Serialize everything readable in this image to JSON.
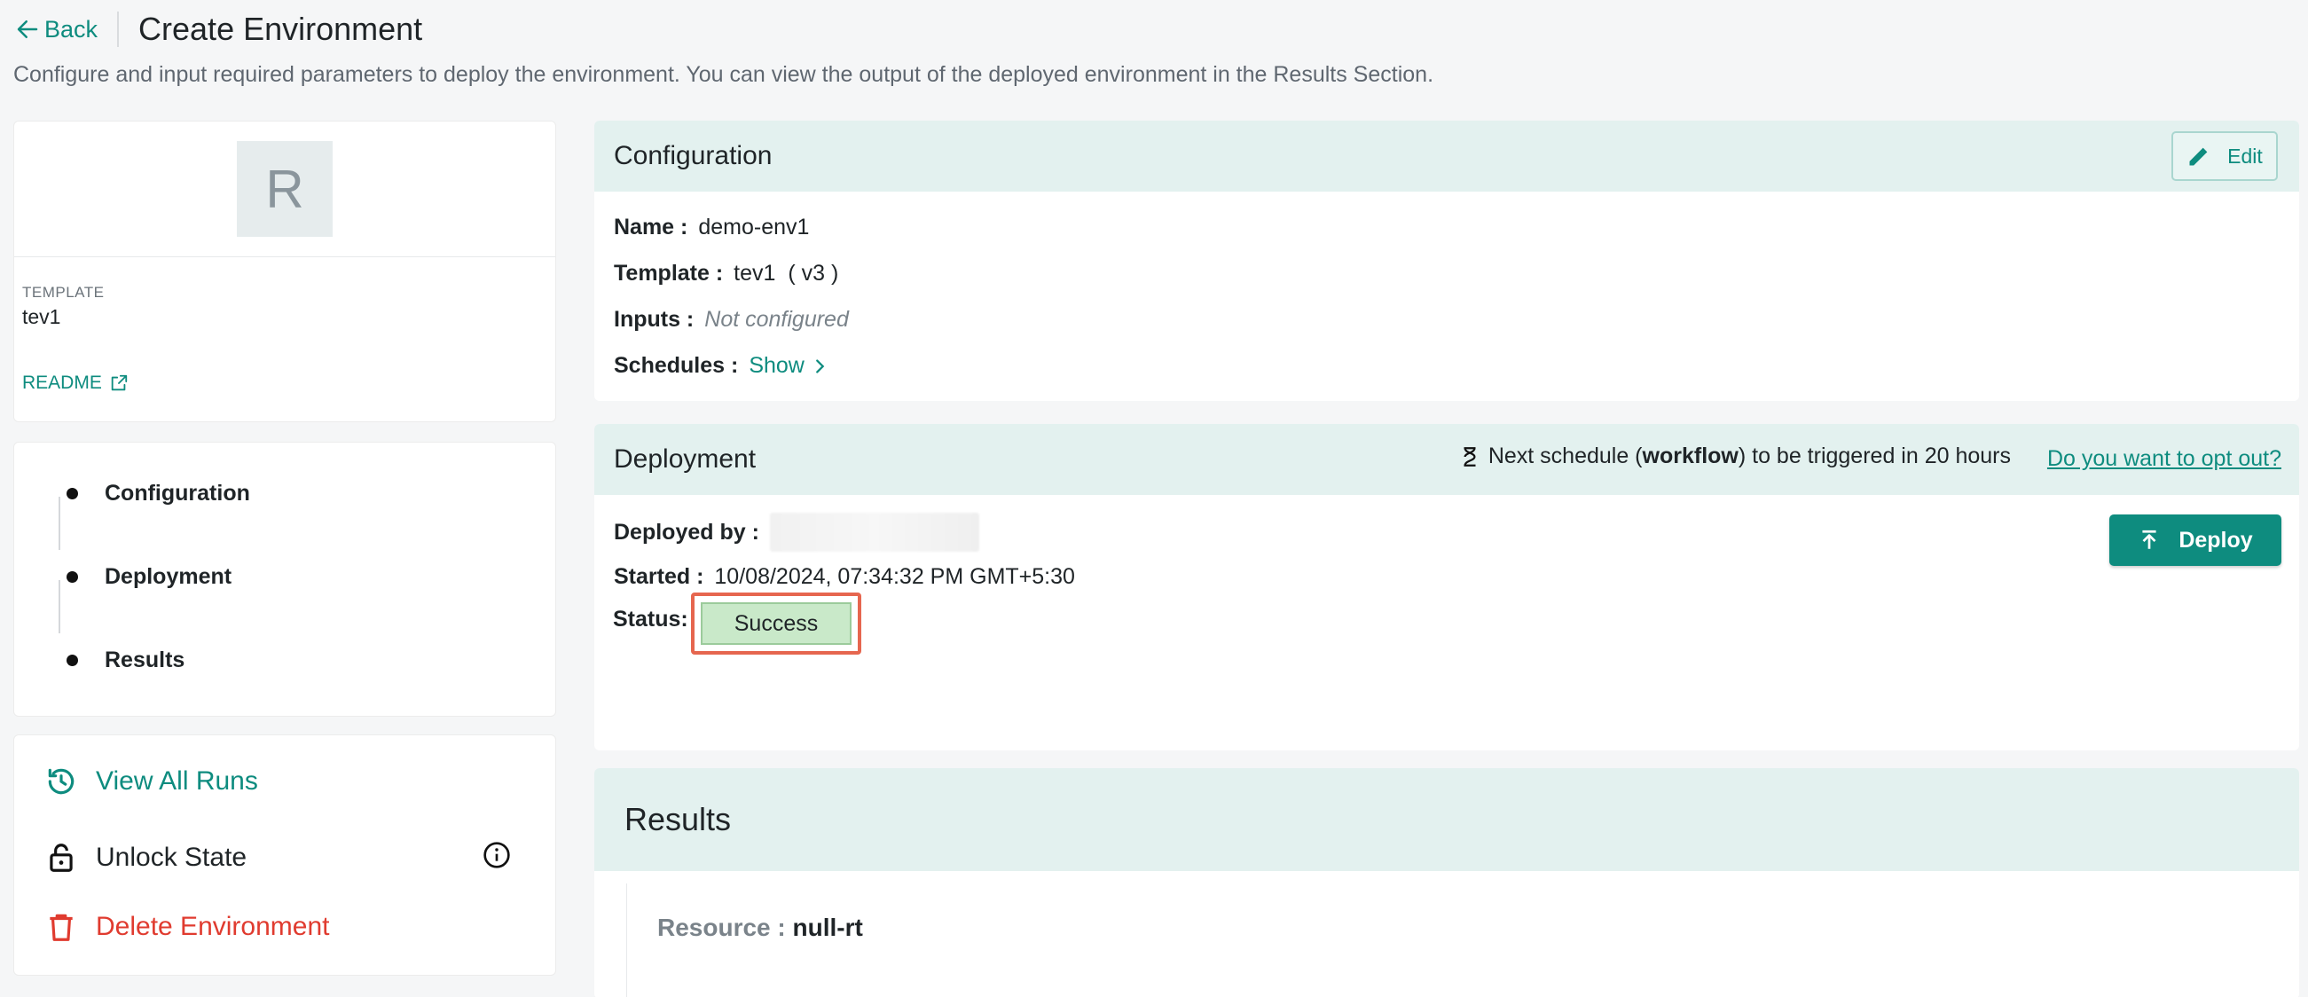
{
  "header": {
    "back_label": "Back",
    "title": "Create Environment",
    "subtitle": "Configure and input required parameters to deploy the environment. You can view the output of the deployed environment in the Results Section."
  },
  "template_card": {
    "avatar_letter": "R",
    "label": "TEMPLATE",
    "name": "tev1",
    "readme_label": "README"
  },
  "steps": [
    {
      "label": "Configuration"
    },
    {
      "label": "Deployment"
    },
    {
      "label": "Results"
    }
  ],
  "actions": {
    "view_runs": "View All Runs",
    "unlock_state": "Unlock State",
    "delete_env": "Delete Environment"
  },
  "configuration": {
    "title": "Configuration",
    "edit_label": "Edit",
    "name_key": "Name :",
    "name_value": "demo-env1",
    "template_key": "Template :",
    "template_value": "tev1  ( v3 )",
    "inputs_key": "Inputs :",
    "inputs_value": "Not configured",
    "schedules_key": "Schedules :",
    "schedules_value": "Show"
  },
  "deployment": {
    "title": "Deployment",
    "next_schedule_prefix": "Next schedule (",
    "next_schedule_bold": "workflow",
    "next_schedule_suffix": ") to be triggered in 20 hours",
    "opt_out": "Do you want to opt out?",
    "deployed_by_key": "Deployed by :",
    "started_key": "Started :",
    "started_value": "10/08/2024, 07:34:32 PM GMT+5:30",
    "status_key": "Status:",
    "status_value": "Success",
    "deploy_label": "Deploy"
  },
  "results": {
    "title": "Results",
    "resource_key": "Resource :",
    "resource_value": "null-rt"
  },
  "colors": {
    "accent": "#0e8c7f",
    "danger": "#e03b2f",
    "panel_header": "#e3f1ef",
    "status_success": "#c9e9c9",
    "highlight_border": "#e6664f"
  }
}
